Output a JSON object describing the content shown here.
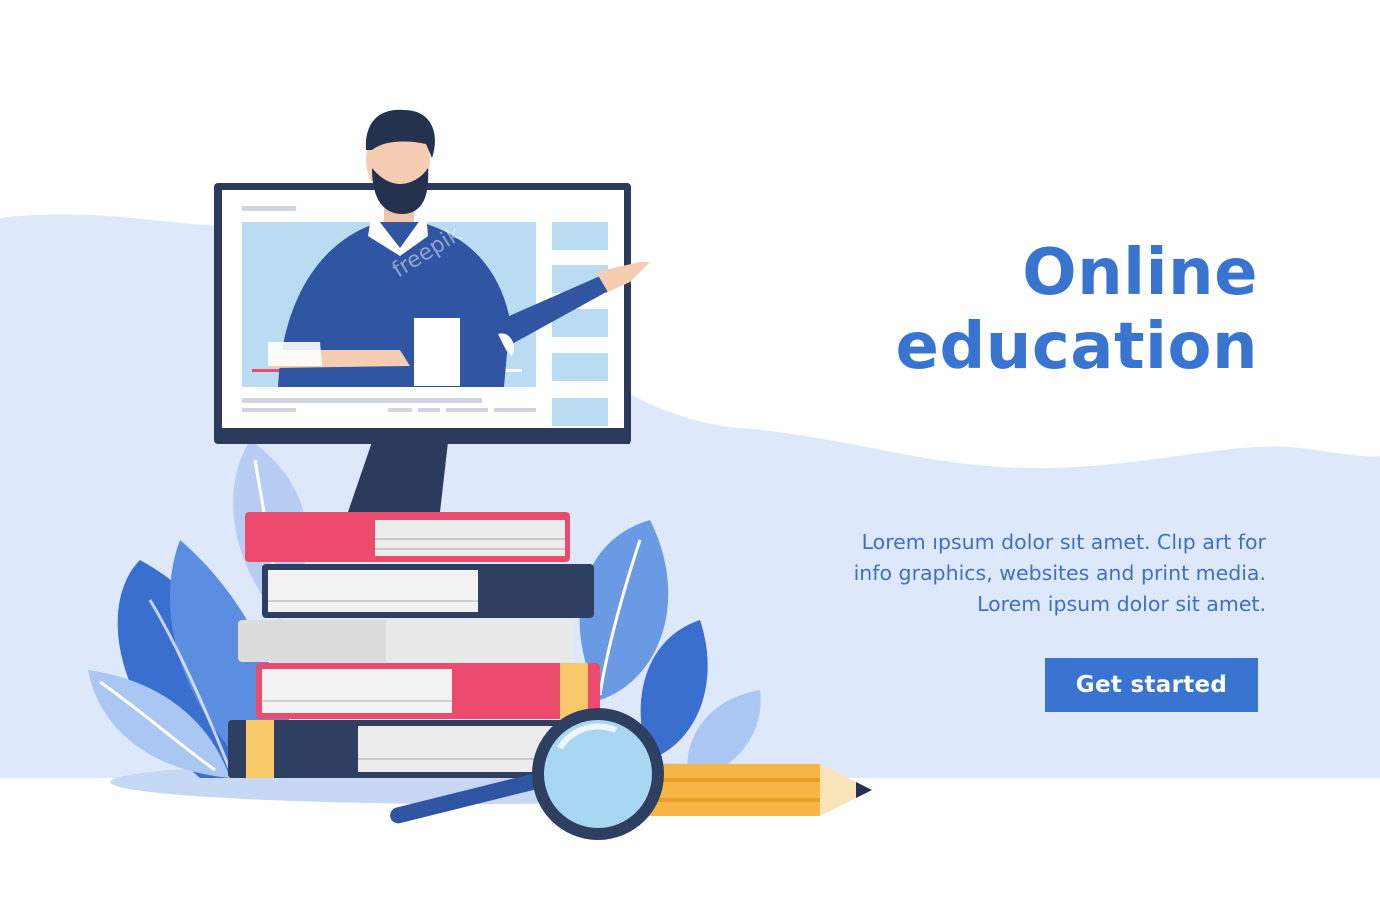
{
  "hero": {
    "title_line1": "Online",
    "title_line2": "education",
    "description_line1": "Lorem ıpsum dolor sıt amet. Clıp art for",
    "description_line2": "info  graphics, websites and print media.",
    "description_line3": "Lorem ipsum dolor sit amet.",
    "cta_label": "Get started",
    "watermark": "freepik"
  },
  "colors": {
    "accent": "#3a74d1",
    "background_wave": "#dde9fb",
    "book_pink": "#ec4b6e",
    "book_navy": "#2f3f62",
    "book_gray": "#dcdcdc",
    "pencil_orange": "#f7b545",
    "monitor_dark": "#2c3b5c",
    "shirt_blue": "#2f55a3"
  },
  "icons": {
    "cta": "none",
    "illustration": "teacher-monitor-books-illustration"
  }
}
